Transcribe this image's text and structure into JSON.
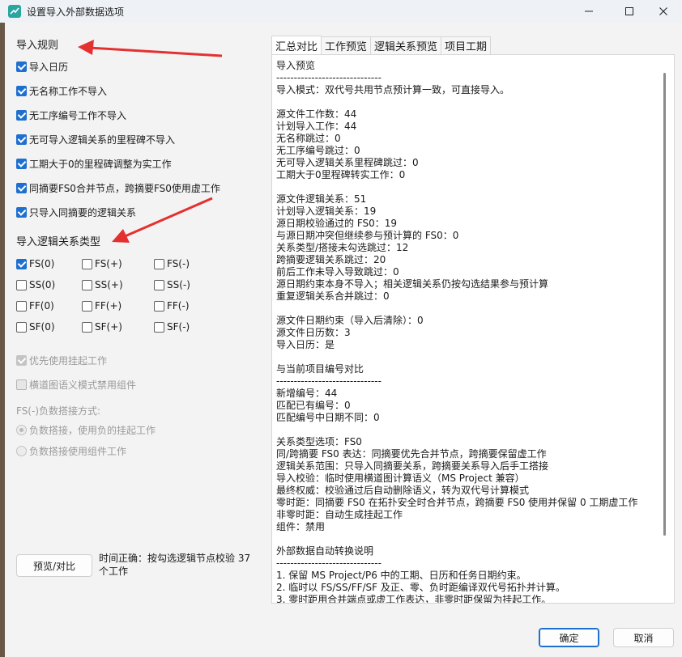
{
  "window": {
    "title": "设置导入外部数据选项",
    "app_icon": "project-app-icon",
    "controls": [
      "minimize-icon",
      "maximize-icon",
      "close-icon"
    ]
  },
  "import_rules": {
    "heading": "导入规则",
    "options": [
      {
        "label": "导入日历",
        "checked": true
      },
      {
        "label": "无名称工作不导入",
        "checked": true
      },
      {
        "label": "无工序编号工作不导入",
        "checked": true
      },
      {
        "label": "无可导入逻辑关系的里程碑不导入",
        "checked": true
      },
      {
        "label": "工期大于0的里程碑调整为实工作",
        "checked": true
      },
      {
        "label": "同摘要FS0合并节点，跨摘要FS0使用虚工作",
        "checked": true
      },
      {
        "label": "只导入同摘要的逻辑关系",
        "checked": true
      }
    ]
  },
  "relation_types": {
    "heading": "导入逻辑关系类型",
    "grid": [
      [
        {
          "label": "FS(0)",
          "checked": true
        },
        {
          "label": "FS(+)",
          "checked": false
        },
        {
          "label": "FS(-)",
          "checked": false
        }
      ],
      [
        {
          "label": "SS(0)",
          "checked": false
        },
        {
          "label": "SS(+)",
          "checked": false
        },
        {
          "label": "SS(-)",
          "checked": false
        }
      ],
      [
        {
          "label": "FF(0)",
          "checked": false
        },
        {
          "label": "FF(+)",
          "checked": false
        },
        {
          "label": "FF(-)",
          "checked": false
        }
      ],
      [
        {
          "label": "SF(0)",
          "checked": false
        },
        {
          "label": "SF(+)",
          "checked": false
        },
        {
          "label": "SF(-)",
          "checked": false
        }
      ]
    ]
  },
  "extra_options": {
    "prefer_suspended": {
      "label": "优先使用挂起工作",
      "checked": true,
      "disabled": true
    },
    "disable_component": {
      "label": "横道图语义模式禁用组件",
      "checked": false,
      "disabled": true
    },
    "negative_lag_label": "FS(-)负数搭接方式:",
    "negative_lag_options": [
      {
        "label": "负数搭接，使用负的挂起工作",
        "selected": true
      },
      {
        "label": "负数搭接使用组件工作",
        "selected": false
      }
    ]
  },
  "preview_button": "预览/对比",
  "status": "时间正确：按勾选逻辑节点校验 37 个工作",
  "tabs": [
    "汇总对比",
    "工作预览",
    "逻辑关系预览",
    "项目工期"
  ],
  "active_tab": "汇总对比",
  "preview_lines": [
    "导入预览",
    "------------------------------",
    "导入模式：双代号共用节点预计算一致，可直接导入。",
    "",
    "源文件工作数：44",
    "计划导入工作：44",
    "无名称跳过：0",
    "无工序编号跳过：0",
    "无可导入逻辑关系里程碑跳过：0",
    "工期大于0里程碑转实工作：0",
    "",
    "源文件逻辑关系：51",
    "计划导入逻辑关系：19",
    "源日期校验通过的 FS0：19",
    "与源日期冲突但继续参与预计算的 FS0：0",
    "关系类型/搭接未勾选跳过：12",
    "跨摘要逻辑关系跳过：20",
    "前后工作未导入导致跳过：0",
    "源日期约束本身不导入；相关逻辑关系仍按勾选结果参与预计算",
    "重复逻辑关系合并跳过：0",
    "",
    "源文件日期约束（导入后清除）：0",
    "源文件日历数：3",
    "导入日历：是",
    "",
    "与当前项目编号对比",
    "------------------------------",
    "新增编号：44",
    "匹配已有编号：0",
    "匹配编号中日期不同：0",
    "",
    "关系类型选项：FS0",
    "同/跨摘要 FS0 表达：同摘要优先合并节点，跨摘要保留虚工作",
    "逻辑关系范围：只导入同摘要关系，跨摘要关系导入后手工搭接",
    "导入校验：临时使用横道图计算语义（MS Project 兼容）",
    "最终权威：校验通过后自动删除语义，转为双代号计算模式",
    "零时距：同摘要 FS0 在拓扑安全时合并节点，跨摘要 FS0 使用并保留 0 工期虚工作",
    "非零时距：自动生成挂起工作",
    "组件：禁用",
    "",
    "外部数据自动转换说明",
    "------------------------------",
    "1. 保留 MS Project/P6 中的工期、日历和任务日期约束。",
    "2. 临时以 FS/SS/FF/SF 及正、零、负时距编译双代号拓扑并计算。",
    "3. 零时距用合并端点或虚工作表达，非零时距保留为挂起工作。"
  ],
  "footer": {
    "ok": "确定",
    "cancel": "取消"
  },
  "colors": {
    "accent": "#1f6fcf",
    "annotation_arrow": "#e53030",
    "window_bg": "#f3f3f3"
  }
}
